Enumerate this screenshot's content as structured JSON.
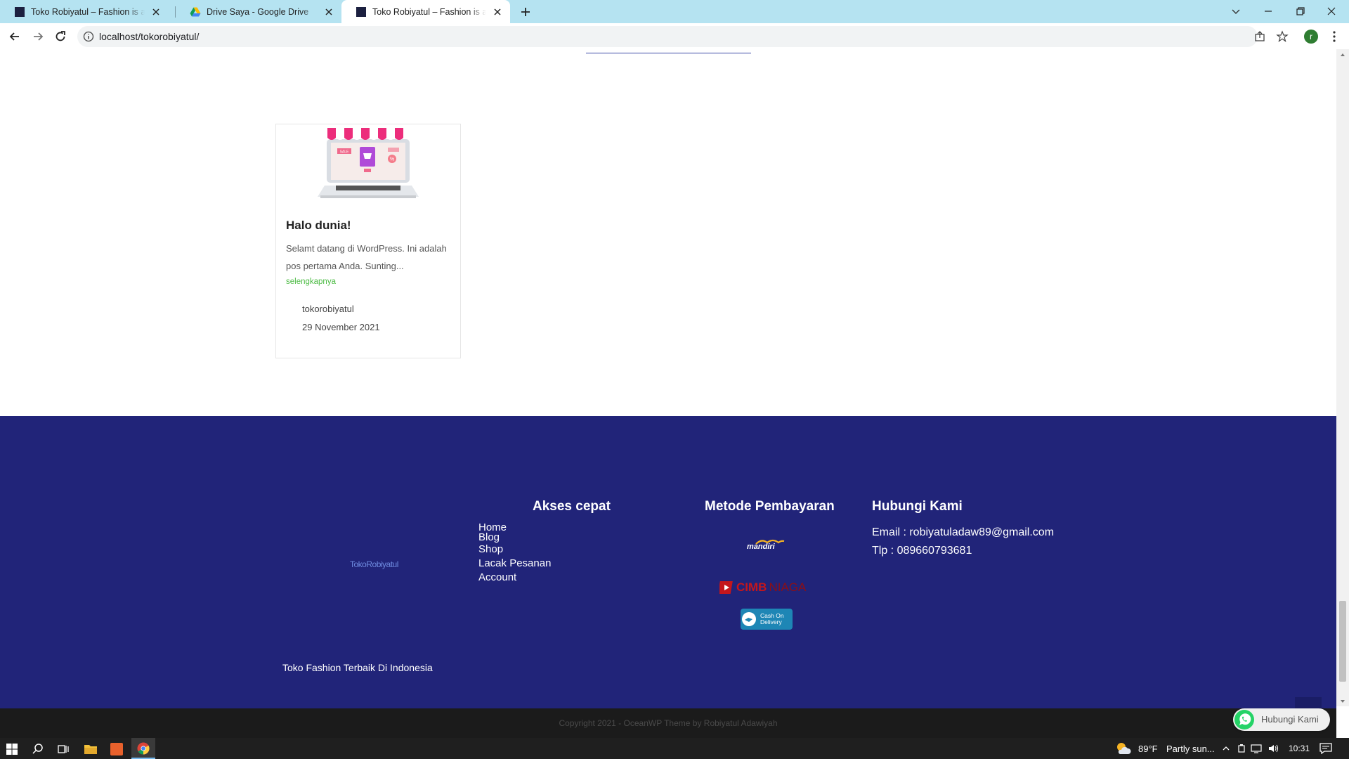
{
  "browser": {
    "tabs": [
      {
        "title": "Toko Robiyatul – Fashion is a style"
      },
      {
        "title": "Drive Saya - Google Drive"
      },
      {
        "title": "Toko Robiyatul – Fashion is a style"
      }
    ],
    "url": "localhost/tokorobiyatul/",
    "profile_initial": "r"
  },
  "post": {
    "title": "Halo dunia!",
    "excerpt": "Selamt datang di WordPress. Ini adalah pos pertama Anda. Sunting...",
    "read_more": "selengkapnya",
    "author": "tokorobiyatul",
    "date": "29 November 2021",
    "image_labels": [
      "SALE",
      "%"
    ]
  },
  "footer": {
    "logo_text": "TokoRobiyatul",
    "tagline": "Toko Fashion Terbaik Di Indonesia",
    "quick_links_heading": "Akses cepat",
    "quick_links": [
      "Home",
      "Blog",
      "Shop",
      "Lacak Pesanan",
      "Account"
    ],
    "payment_heading": "Metode Pembayaran",
    "payment_logos": {
      "mandiri": "mandiri",
      "cimb": [
        "CIMB",
        "NIAGA"
      ],
      "cod": [
        "Cash On",
        "Delivery"
      ]
    },
    "contact_heading": "Hubungi Kami",
    "email": "Email : robiyatuladaw89@gmail.com",
    "phone": "Tlp : 089660793681",
    "copyright": "Copyright 2021 - OceanWP Theme by Robiyatul Adawiyah"
  },
  "whatsapp_button": "Hubungi Kami",
  "taskbar": {
    "temperature": "89°F",
    "weather": "Partly sun...",
    "time": "10:31"
  },
  "colors": {
    "footer_bg": "#212479",
    "tabbar_bg": "#b5e3f1",
    "read_more": "#4cbb44"
  }
}
